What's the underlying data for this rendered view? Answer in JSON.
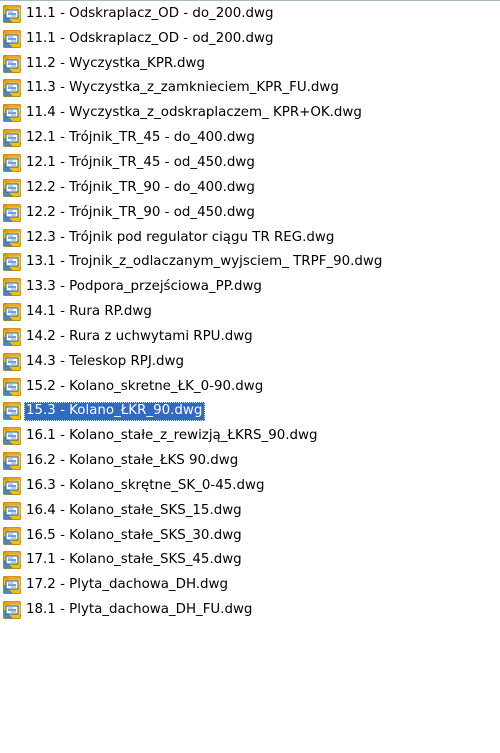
{
  "explorer": {
    "icon": "dwg-file-icon",
    "colors": {
      "selection_background": "#316ac5",
      "selection_text": "#ffffff",
      "text": "#000000",
      "icon_yellow": "#f2c100",
      "icon_blue": "#1f5fbf"
    },
    "files": [
      {
        "name": "11.1 - Odskraplacz_OD - do_200.dwg",
        "selected": false
      },
      {
        "name": "11.1 - Odskraplacz_OD - od_200.dwg",
        "selected": false
      },
      {
        "name": "11.2 - Wyczystka_KPR.dwg",
        "selected": false
      },
      {
        "name": "11.3 - Wyczystka_z_zamknieciem_KPR_FU.dwg",
        "selected": false
      },
      {
        "name": "11.4 - Wyczystka_z_odskraplaczem_ KPR+OK.dwg",
        "selected": false
      },
      {
        "name": "12.1 - Trójnik_TR_45 - do_400.dwg",
        "selected": false
      },
      {
        "name": "12.1 - Trójnik_TR_45 - od_450.dwg",
        "selected": false
      },
      {
        "name": "12.2 - Trójnik_TR_90 - do_400.dwg",
        "selected": false
      },
      {
        "name": "12.2 - Trójnik_TR_90 - od_450.dwg",
        "selected": false
      },
      {
        "name": "12.3 - Trójnik pod regulator ciągu TR REG.dwg",
        "selected": false
      },
      {
        "name": "13.1 - Trojnik_z_odlaczanym_wyjsciem_ TRPF_90.dwg",
        "selected": false
      },
      {
        "name": "13.3 - Podpora_przejściowa_PP.dwg",
        "selected": false
      },
      {
        "name": "14.1 - Rura RP.dwg",
        "selected": false
      },
      {
        "name": "14.2 - Rura z uchwytami RPU.dwg",
        "selected": false
      },
      {
        "name": "14.3 - Teleskop RPJ.dwg",
        "selected": false
      },
      {
        "name": "15.2 - Kolano_skretne_ŁK_0-90.dwg",
        "selected": false
      },
      {
        "name": "15.3 - Kolano_ŁKR_90.dwg",
        "selected": true
      },
      {
        "name": "16.1 - Kolano_stałe_z_rewizją_ŁKRS_90.dwg",
        "selected": false
      },
      {
        "name": "16.2 - Kolano_stałe_ŁKS 90.dwg",
        "selected": false
      },
      {
        "name": "16.3 - Kolano_skrętne_SK_0-45.dwg",
        "selected": false
      },
      {
        "name": "16.4 - Kolano_stałe_SKS_15.dwg",
        "selected": false
      },
      {
        "name": "16.5 - Kolano_stałe_SKS_30.dwg",
        "selected": false
      },
      {
        "name": "17.1 - Kolano_stałe_SKS_45.dwg",
        "selected": false
      },
      {
        "name": "17.2 - Plyta_dachowa_DH.dwg",
        "selected": false
      },
      {
        "name": "18.1 - Plyta_dachowa_DH_FU.dwg",
        "selected": false
      }
    ]
  }
}
